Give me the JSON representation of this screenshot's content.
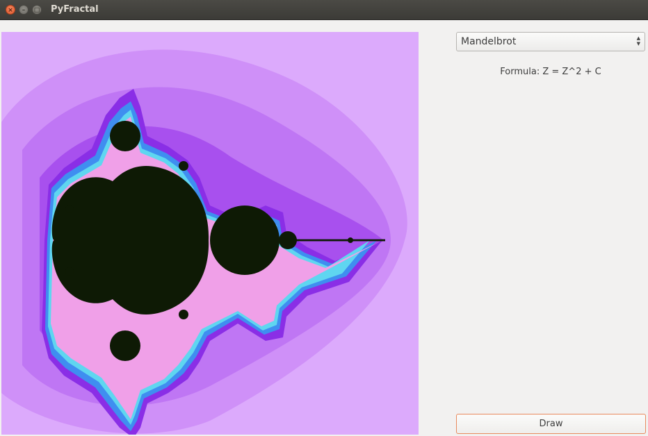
{
  "window": {
    "title": "PyFractal",
    "close_symbol": "×",
    "min_symbol": "–",
    "max_symbol": "□"
  },
  "controls": {
    "fractal_select_value": "Mandelbrot",
    "formula": "Formula: Z = Z^2 + C",
    "draw_label": "Draw"
  },
  "colors": {
    "background": "#dcaafc",
    "set": "#0e1a05",
    "band_outer": "#cf90f8",
    "band_mid": "#bf76f4",
    "band_inner": "#a850ee",
    "band_violet": "#8a2ee6",
    "edge_blue": "#3f8ef0",
    "edge_cyan": "#5fd6f0",
    "edge_pink": "#f0a0e8",
    "accent_button_border": "#e88a5d"
  },
  "icons": {
    "select_arrows": "up-down-arrows-icon"
  }
}
